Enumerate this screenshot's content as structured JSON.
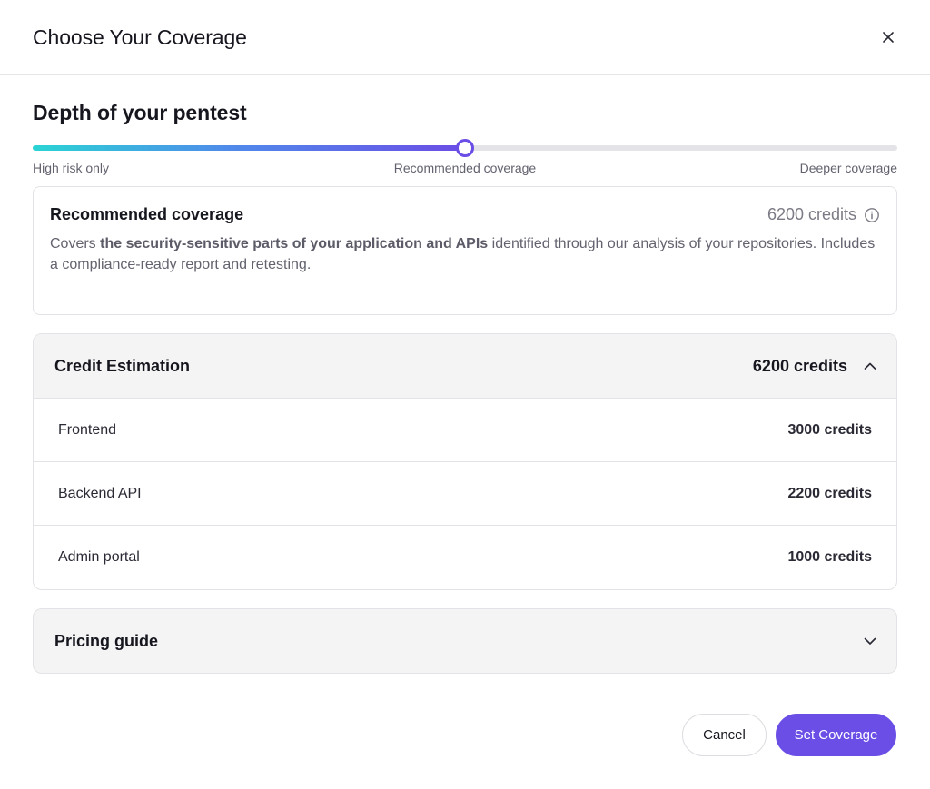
{
  "dialog": {
    "title": "Choose Your Coverage"
  },
  "depth": {
    "title": "Depth of your pentest",
    "slider": {
      "value_fraction": 0.5,
      "labels": {
        "left": "High risk only",
        "middle": "Recommended coverage",
        "right": "Deeper coverage"
      }
    }
  },
  "coverage_card": {
    "name": "Recommended coverage",
    "credits": "6200 credits",
    "desc_prefix": "Covers ",
    "desc_bold": "the security-sensitive parts of your application and APIs",
    "desc_suffix": " identified through our analysis of your repositories. Includes a compliance-ready report and retesting."
  },
  "estimation": {
    "title": "Credit Estimation",
    "total": "6200 credits",
    "expanded": true,
    "rows": [
      {
        "name": "Frontend",
        "value": "3000 credits"
      },
      {
        "name": "Backend API",
        "value": "2200 credits"
      },
      {
        "name": "Admin portal",
        "value": "1000 credits"
      }
    ]
  },
  "pricing": {
    "title": "Pricing guide",
    "expanded": false
  },
  "footer": {
    "cancel_label": "Cancel",
    "submit_label": "Set Coverage"
  },
  "colors": {
    "accent": "#6a4ee6",
    "gradient_start": "#2ad4d4",
    "panel_bg": "#f4f4f5",
    "border": "#e3e3e7"
  },
  "icons": {
    "close": "close-icon",
    "info": "info-icon",
    "collapse": "chevron-up-icon",
    "expand": "chevron-down-icon"
  }
}
